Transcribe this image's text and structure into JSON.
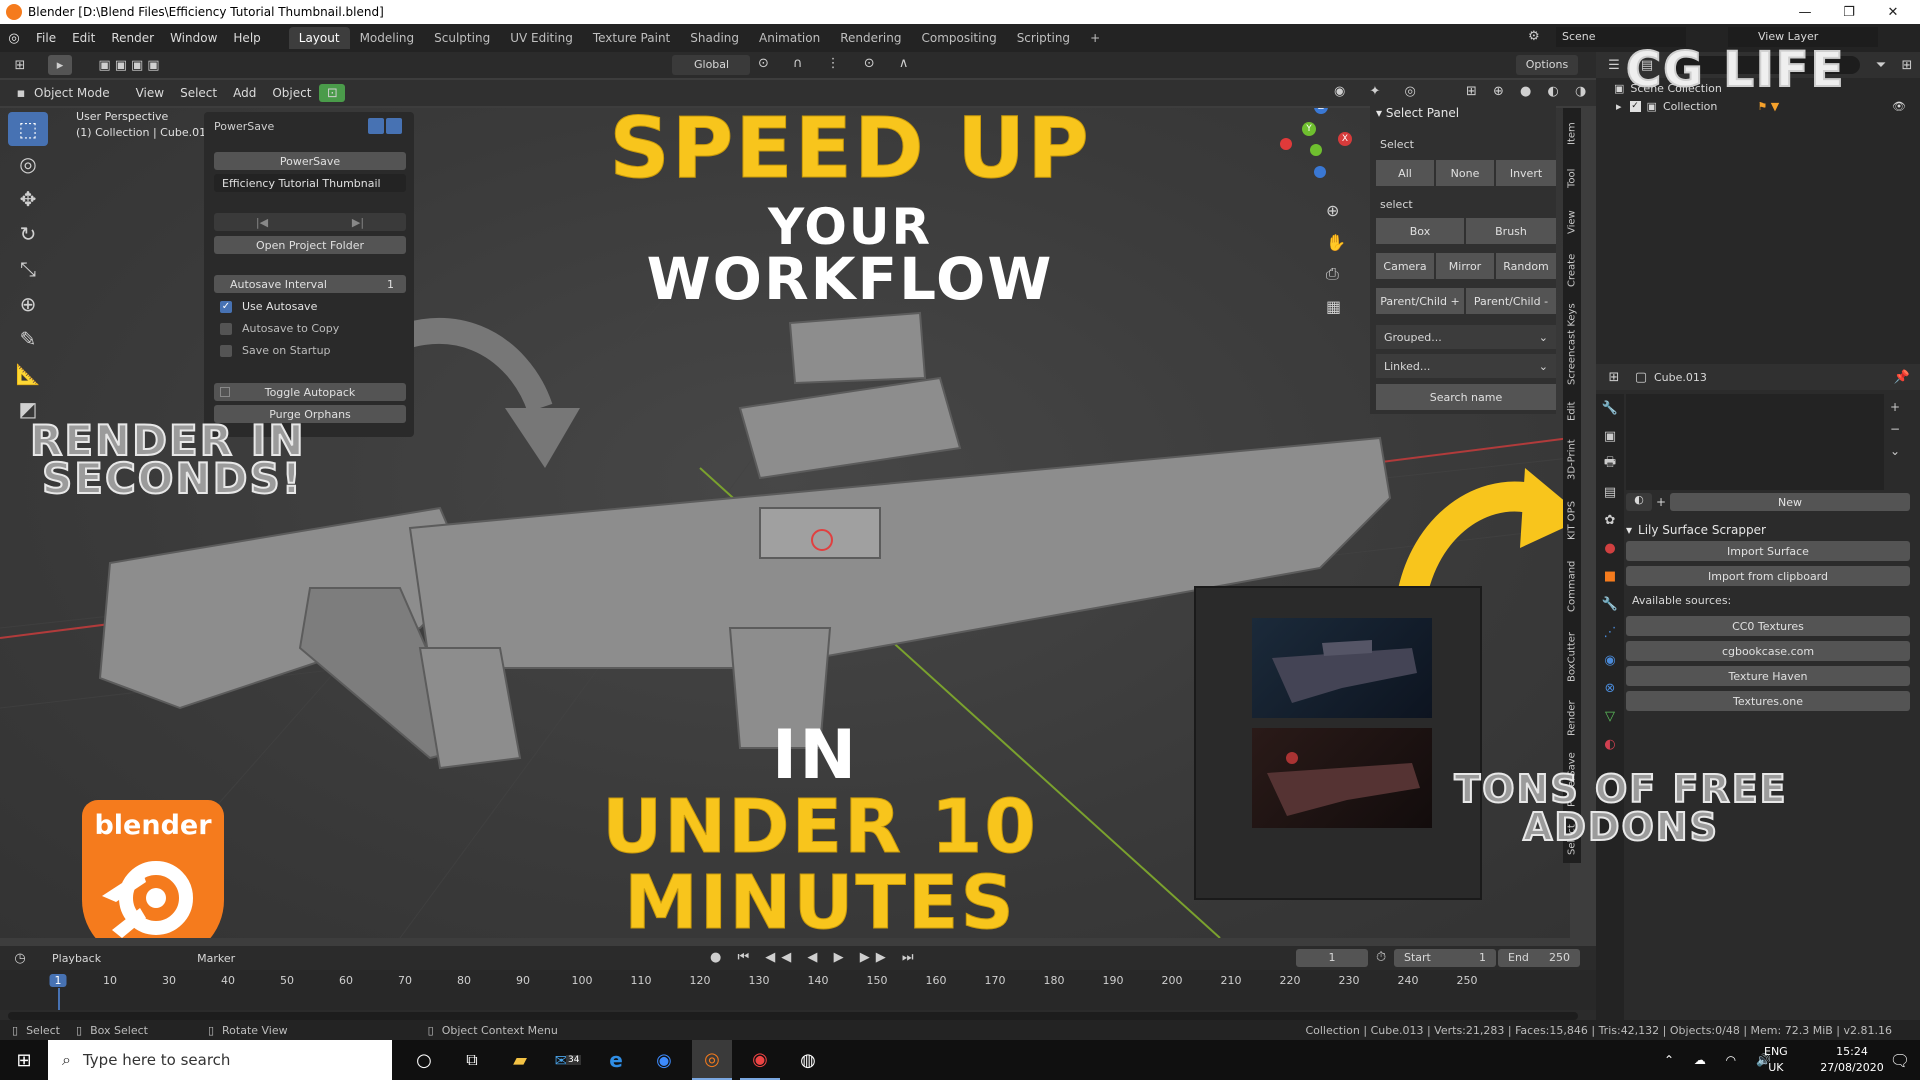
{
  "titlebar": {
    "title": "Blender [D:\\Blend Files\\Efficiency Tutorial Thumbnail.blend]",
    "minimize": "—",
    "restore": "❐",
    "close": "✕"
  },
  "menus": [
    "File",
    "Edit",
    "Render",
    "Window",
    "Help"
  ],
  "workspaces": [
    "Layout",
    "Modeling",
    "Sculpting",
    "UV Editing",
    "Texture Paint",
    "Shading",
    "Animation",
    "Rendering",
    "Compositing",
    "Scripting",
    "+"
  ],
  "scene": {
    "scene_name": "Scene",
    "view_layer": "View Layer"
  },
  "viewport_header": {
    "mode": "Object Mode",
    "view": "View",
    "select": "Select",
    "add": "Add",
    "object": "Object",
    "orientation": "Global",
    "options": "Options"
  },
  "viewport_overlay": {
    "perspective": "User Perspective",
    "collection_info": "(1) Collection | Cube.013"
  },
  "powersave_panel": {
    "title": "PowerSave",
    "powersave_button": "PowerSave",
    "filename": "Efficiency Tutorial Thumbnail",
    "prev_icon": "|◀",
    "next_icon": "▶|",
    "open_folder": "Open Project Folder",
    "autosave_interval_label": "Autosave Interval",
    "autosave_interval_value": "1",
    "use_autosave": "Use Autosave",
    "autosave_copy": "Autosave to Copy",
    "save_startup": "Save on Startup",
    "toggle_autopack": "Toggle Autopack",
    "purge_orphans": "Purge Orphans"
  },
  "select_panel": {
    "title": "Select Panel",
    "select_label": "Select",
    "all": "All",
    "none": "None",
    "invert": "Invert",
    "select_lower": "select",
    "box": "Box",
    "brush": "Brush",
    "camera": "Camera",
    "mirror": "Mirror",
    "random": "Random",
    "parent_child_plus": "Parent/Child +",
    "parent_child_minus": "Parent/Child -",
    "grouped": "Grouped...",
    "linked": "Linked...",
    "search_name": "Search name"
  },
  "side_tabs": [
    "Item",
    "Tool",
    "View",
    "Create",
    "Screencast Keys",
    "Edit",
    "3D-Print",
    "KIT OPS",
    "Command",
    "BoxCutter",
    "Render",
    "PowerSave",
    "Select"
  ],
  "gizmo": {
    "z": "Z",
    "y": "Y",
    "x": "X"
  },
  "outliner": {
    "scene_collection": "Scene Collection",
    "collection": "Collection"
  },
  "properties": {
    "object_name": "Cube.013",
    "new_button": "New",
    "addon_title": "Lily Surface Scrapper",
    "import_surface": "Import Surface",
    "import_clipboard": "Import from clipboard",
    "available_sources": "Available sources:",
    "sources": [
      "CC0 Textures",
      "cgbookcase.com",
      "Texture Haven",
      "Textures.one"
    ]
  },
  "timeline": {
    "playback": "Playback",
    "marker": "Marker",
    "current_frame": "1",
    "start_label": "Start",
    "start": "1",
    "end_label": "End",
    "end": "250",
    "ruler": [
      "1",
      "10",
      "30",
      "40",
      "50",
      "60",
      "70",
      "80",
      "90",
      "100",
      "110",
      "120",
      "130",
      "140",
      "150",
      "160",
      "170",
      "180",
      "190",
      "200",
      "210",
      "220",
      "230",
      "240",
      "250"
    ]
  },
  "statusbar": {
    "select": "Select",
    "box_select": "Box Select",
    "rotate_view": "Rotate View",
    "context_menu": "Object Context Menu",
    "stats": "Collection | Cube.013 | Verts:21,283 | Faces:15,846 | Tris:42,132 | Objects:0/48 | Mem: 72.3 MiB | v2.81.16"
  },
  "taskbar": {
    "search_placeholder": "Type here to search",
    "mail_badge": "34",
    "lang": "ENG",
    "region": "UK",
    "time": "15:24",
    "date": "27/08/2020"
  },
  "overlay": {
    "speed_up": "SPEED UP",
    "your": "YOUR",
    "workflow": "WORKFLOW",
    "render_in": "RENDER IN",
    "seconds": "SECONDS!",
    "in": "IN",
    "under_10": "UNDER 10",
    "minutes": "MINUTES",
    "tons_of_free": "TONS OF FREE",
    "addons": "ADDONS",
    "cg_life": "CG LIFE",
    "blender_logo_text": "blender"
  },
  "colors": {
    "accent_yellow": "#f8c51c",
    "blender_orange": "#f57b1d",
    "active_blue": "#4772b3"
  }
}
